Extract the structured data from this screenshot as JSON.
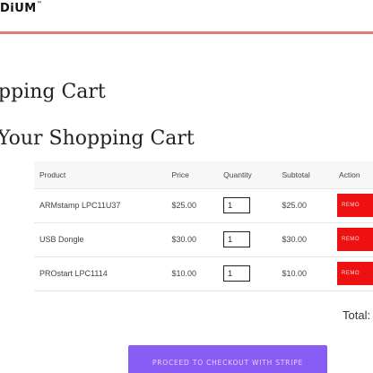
{
  "header": {
    "brand": "DiUM",
    "trademark": "™"
  },
  "page_title": "pping Cart",
  "section_title": "Your Shopping Cart",
  "cart": {
    "columns": {
      "product": "Product",
      "price": "Price",
      "quantity": "Quantity",
      "subtotal": "Subtotal",
      "action": "Action"
    },
    "rows": [
      {
        "product": "ARMstamp LPC11U37",
        "price": "$25.00",
        "quantity": "1",
        "subtotal": "$25.00",
        "action": "REMO"
      },
      {
        "product": "USB Dongle",
        "price": "$30.00",
        "quantity": "1",
        "subtotal": "$30.00",
        "action": "REMO"
      },
      {
        "product": "PROstart LPC1114",
        "price": "$10.00",
        "quantity": "1",
        "subtotal": "$10.00",
        "action": "REMO"
      }
    ],
    "total_label": "Total:"
  },
  "checkout": {
    "label": "PROCEED TO CHECKOUT WITH STRIPE"
  },
  "colors": {
    "accent_rule": "#e07a7a",
    "remove_button": "#ee1111",
    "checkout_button": "#8a5cf6"
  }
}
